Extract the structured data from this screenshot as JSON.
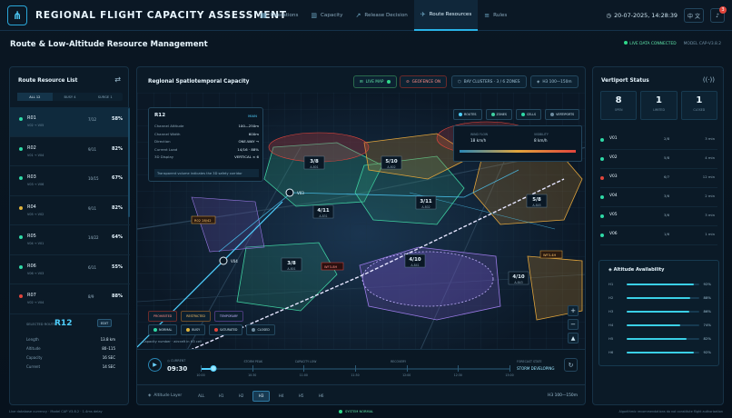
{
  "app": {
    "title": "REGIONAL FLIGHT CAPACITY ASSESSMENT",
    "datetime": "20-07-2025, 14:28:39",
    "lang": "中 文",
    "notifications": "3"
  },
  "nav": [
    {
      "label": "Operations",
      "icon": "grid-icon"
    },
    {
      "label": "Capacity",
      "icon": "bar-chart-icon"
    },
    {
      "label": "Release Decision",
      "icon": "trend-icon"
    },
    {
      "label": "Route Resources",
      "icon": "plane-icon",
      "active": true
    },
    {
      "label": "Rules",
      "icon": "rules-icon"
    }
  ],
  "page": {
    "title": "Route & Low-Altitude Resource Management",
    "live": "LIVE DATA CONNECTED",
    "model": "MODEL CAP-V3.8.2"
  },
  "left": {
    "title": "Route Resource List",
    "filters": [
      "ALL 12",
      "BUSY 4",
      "SURGE 1"
    ],
    "routes": [
      {
        "id": "R01",
        "sub": "V02 → V05",
        "load": "7/12",
        "pct": "58%",
        "color": "#2fd9a6"
      },
      {
        "id": "R02",
        "sub": "V01 → V04",
        "load": "9/11",
        "pct": "82%",
        "color": "#2fd9a6"
      },
      {
        "id": "R03",
        "sub": "V03 → V06",
        "load": "10/15",
        "pct": "67%",
        "color": "#2fd9a6"
      },
      {
        "id": "R04",
        "sub": "V05 → V02",
        "load": "9/11",
        "pct": "82%",
        "color": "#e0b43c"
      },
      {
        "id": "R05",
        "sub": "V04 → V01",
        "load": "14/22",
        "pct": "64%",
        "color": "#2fd9a6"
      },
      {
        "id": "R06",
        "sub": "V06 → V03",
        "load": "6/11",
        "pct": "55%",
        "color": "#2fd9a6"
      },
      {
        "id": "R07",
        "sub": "V02 → V04",
        "load": "8/9",
        "pct": "88%",
        "color": "#e2453c"
      }
    ],
    "selected": {
      "label": "SELECTED ROUTE",
      "id": "R12",
      "btn": "EDIT",
      "rows": [
        [
          "Length",
          "13.8 km"
        ],
        [
          "Altitude",
          "80–115"
        ],
        [
          "Capacity",
          "16 SEC"
        ],
        [
          "Current",
          "14 SEC"
        ]
      ]
    },
    "footer": "Live database currency · Model CAP V3.8.2 · 1.4ms delay"
  },
  "center": {
    "title": "Regional Spatiotemporal Capacity",
    "tools": [
      "LIVE MAP",
      "GEOFENCE ON",
      "BAY CLUSTERS · 3 / 6 ZONES",
      "H3 100—150m"
    ],
    "info": {
      "id": "R12",
      "tag": "MAIN",
      "rows": [
        [
          "Channel Altitude",
          "100—250m"
        ],
        [
          "Channel Width",
          "600m"
        ],
        [
          "Direction",
          "ONE-WAY →"
        ],
        [
          "Current Load",
          "14/16 · 88%"
        ],
        [
          "3D Display",
          "VERTICAL × 6"
        ]
      ],
      "note": "Transparent volume indicates the 3D safety corridor"
    },
    "filterchips": [
      "ROUTES",
      "ZONES",
      "CELLS",
      "VERTIPORTS"
    ],
    "wind": {
      "label": "WIND FLOW",
      "value": "18 km/h",
      "label2": "VISIBILITY",
      "value2": "8 km/h"
    },
    "zones": [
      {
        "label": "3/8",
        "sub": "A-801"
      },
      {
        "label": "5/10",
        "sub": "A-802"
      },
      {
        "label": "4/11",
        "sub": "A-831"
      },
      {
        "label": "3/11",
        "sub": "A-802"
      },
      {
        "label": "5/8",
        "sub": "A-845"
      },
      {
        "label": "3/8",
        "sub": "A-801"
      },
      {
        "label": "4/10",
        "sub": "A-841"
      },
      {
        "label": "4/10",
        "sub": "A-843"
      }
    ],
    "vertiports": [
      "V03",
      "V04"
    ],
    "alerts": [
      "R02  28/42",
      "WF3-8H",
      "WF3-4H"
    ],
    "legend": [
      "PROHIBITED",
      "RESTRICTED",
      "TEMPORARY"
    ],
    "states": [
      "NORMAL",
      "BUSY",
      "SATURATED",
      "CLOSED"
    ],
    "footnote": "Capacity number · aircraft in H3 cell",
    "timeline": {
      "label": "CURRENT",
      "time": "09:30",
      "ticks": [
        "10:00",
        "10:30",
        "11:00",
        "11:30",
        "12:00",
        "12:30",
        "13:00"
      ],
      "events": [
        "STORM PEAK",
        "CAPACITY LOW",
        "RECOVERY"
      ],
      "evtLabel": "FORECAST STATE",
      "evtValue": "STORM DEVELOPING",
      "progress": 0.04
    },
    "altitude": {
      "label": "Altitude Layer",
      "layers": [
        "ALL",
        "H1",
        "H2",
        "H3",
        "H4",
        "H5",
        "H6"
      ],
      "active": "H3",
      "range": "H3 100—150m"
    }
  },
  "right": {
    "title": "Vertiport Status",
    "stats": [
      {
        "n": "8",
        "l": "OPEN"
      },
      {
        "n": "1",
        "l": "LIMITED"
      },
      {
        "n": "1",
        "l": "CLOSED"
      }
    ],
    "ports": [
      {
        "id": "V01",
        "q": "2/8",
        "w": "3 min",
        "color": "#2fd9a6"
      },
      {
        "id": "V02",
        "q": "5/8",
        "w": "4 min",
        "color": "#2fd9a6"
      },
      {
        "id": "V03",
        "q": "6/7",
        "w": "12 min",
        "color": "#e2453c"
      },
      {
        "id": "V04",
        "q": "3/6",
        "w": "2 min",
        "color": "#2fd9a6"
      },
      {
        "id": "V05",
        "q": "3/6",
        "w": "3 min",
        "color": "#2fd9a6"
      },
      {
        "id": "V06",
        "q": "1/6",
        "w": "1 min",
        "color": "#2fd9a6"
      }
    ],
    "altTitle": "Altitude Availability",
    "alt": [
      {
        "k": "H1",
        "p": 0.92,
        "label": "92%"
      },
      {
        "k": "H2",
        "p": 0.88,
        "label": "88%"
      },
      {
        "k": "H3",
        "p": 0.86,
        "label": "86%"
      },
      {
        "k": "H4",
        "p": 0.74,
        "label": "74%"
      },
      {
        "k": "H5",
        "p": 0.82,
        "label": "82%"
      },
      {
        "k": "H6",
        "p": 0.92,
        "label": "92%"
      }
    ],
    "footer": "Algorithmic recommendations do not constitute flight authorization"
  },
  "statusbar": "SYSTEM NORMAL"
}
